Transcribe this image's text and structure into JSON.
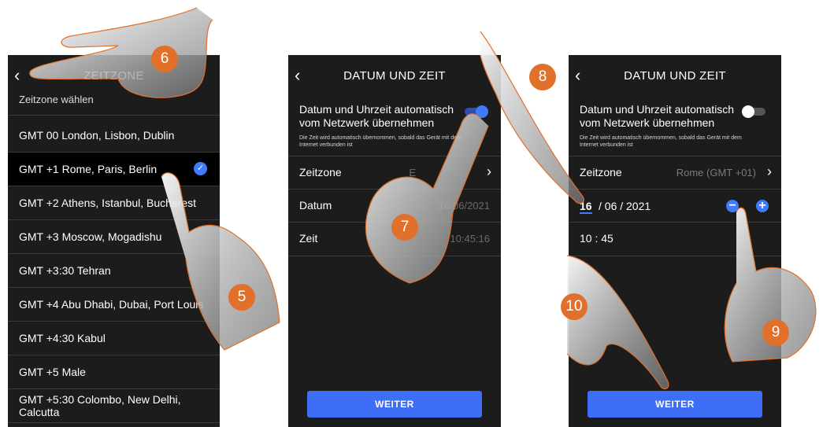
{
  "screen1": {
    "back_icon": "chevron-left-icon",
    "title": "ZEITZONE",
    "subtitle": "Zeitzone wählen",
    "items": [
      {
        "label": "GMT 00 London, Lisbon, Dublin",
        "selected": false
      },
      {
        "label": "GMT +1 Rome, Paris, Berlin",
        "selected": true
      },
      {
        "label": "GMT +2 Athens, Istanbul, Bucharest",
        "selected": false
      },
      {
        "label": "GMT +3 Moscow, Mogadishu",
        "selected": false
      },
      {
        "label": "GMT +3:30 Tehran",
        "selected": false
      },
      {
        "label": "GMT +4 Abu Dhabi, Dubai, Port Louis",
        "selected": false
      },
      {
        "label": "GMT +4:30 Kabul",
        "selected": false
      },
      {
        "label": "GMT +5 Male",
        "selected": false
      },
      {
        "label": "GMT +5:30 Colombo, New Delhi, Calcutta",
        "selected": false
      }
    ]
  },
  "screen2": {
    "title": "DATUM UND ZEIT",
    "auto_label": "Datum und Uhrzeit automatisch vom Netzwerk übernehmen",
    "auto_note": "Die Zeit wird automatisch übernommen, sobald das Gerät mit dem Internet verbunden ist",
    "auto_enabled": true,
    "timezone_label": "Zeitzone",
    "timezone_value": "E",
    "date_label": "Datum",
    "date_value": "16/06/2021",
    "time_label": "Zeit",
    "time_value": "10:45:16",
    "button": "WEITER"
  },
  "screen3": {
    "title": "DATUM UND ZEIT",
    "auto_label": "Datum und Uhrzeit automatisch vom Netzwerk übernehmen",
    "auto_note": "Die Zeit wird automatisch übernommen, sobald das Gerät mit dem Internet verbunden ist",
    "auto_enabled": false,
    "timezone_label": "Zeitzone",
    "timezone_value": "Rome (GMT +01)",
    "date_day": "16",
    "date_rest": "/ 06 / 2021",
    "time_value": "10 : 45",
    "minus": "−",
    "plus": "+",
    "button": "WEITER"
  },
  "steps": [
    "5",
    "6",
    "7",
    "8",
    "9",
    "10"
  ],
  "colors": {
    "accent": "#3d6ef5",
    "badge": "#e0702a",
    "screen_bg": "#1c1c1c"
  }
}
